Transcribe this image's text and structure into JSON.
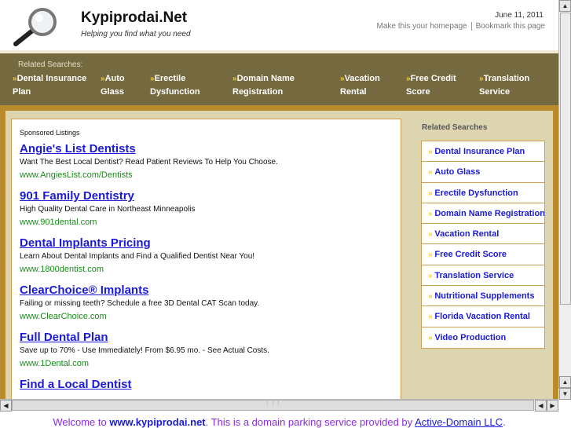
{
  "header": {
    "title": "Kypiprodai.Net",
    "tagline": "Helping you find what you need",
    "date": "June 11, 2011",
    "make_homepage": "Make this your homepage",
    "bookmark": "Bookmark this page"
  },
  "nav": {
    "label": "Related Searches:",
    "items": [
      "Dental Insurance Plan",
      "Auto Glass",
      "Erectile Dysfunction",
      "Domain Name Registration",
      "Vacation Rental",
      "Free Credit Score",
      "Translation Service"
    ]
  },
  "main": {
    "sponsored_label": "Sponsored Listings",
    "listings": [
      {
        "title": "Angie's List Dentists",
        "desc": "Want The Best Local Dentist? Read Patient Reviews To Help You Choose.",
        "url": "www.AngiesList.com/Dentists"
      },
      {
        "title": "901 Family Dentistry",
        "desc": "High Quality Dental Care in Northeast Minneapolis",
        "url": "www.901dental.com"
      },
      {
        "title": "Dental Implants Pricing",
        "desc": "Learn About Dental Implants and Find a Qualified Dentist Near You!",
        "url": "www.1800dentist.com"
      },
      {
        "title": "ClearChoice® Implants",
        "desc": "Failing or missing teeth? Schedule a free 3D Dental CAT Scan today.",
        "url": "www.ClearChoice.com"
      },
      {
        "title": "Full Dental Plan",
        "desc": "Save up to 70% - Use Immediately! From $6.95 mo. - See Actual Costs.",
        "url": "www.1Dental.com"
      },
      {
        "title": "Find a Local Dentist",
        "desc": "",
        "url": ""
      }
    ]
  },
  "sidebar": {
    "title": "Related Searches",
    "items": [
      "Dental Insurance Plan",
      "Auto Glass",
      "Erectile Dysfunction",
      "Domain Name Registration",
      "Vacation Rental",
      "Free Credit Score",
      "Translation Service",
      "Nutritional Supplements",
      "Florida Vacation Rental",
      "Video Production"
    ]
  },
  "footer": {
    "prefix": "Welcome to ",
    "domain": "www.kypiprodai.net",
    "middle": ". This is a domain parking service provided by ",
    "provider": "Active-Domain LLC",
    "suffix": "."
  }
}
